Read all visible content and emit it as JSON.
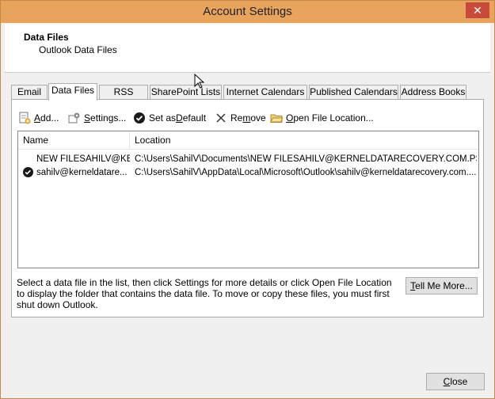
{
  "window": {
    "title": "Account Settings",
    "close_glyph": "✕"
  },
  "header": {
    "title": "Data Files",
    "subtitle": "Outlook Data Files"
  },
  "tabs": [
    {
      "label": "Email"
    },
    {
      "label": "Data Files"
    },
    {
      "label": "RSS Feeds"
    },
    {
      "label": "SharePoint Lists"
    },
    {
      "label": "Internet Calendars"
    },
    {
      "label": "Published Calendars"
    },
    {
      "label": "Address Books"
    }
  ],
  "toolbar": {
    "add_prefix": "",
    "add_u": "A",
    "add_rest": "dd...",
    "settings_prefix": "",
    "settings_u": "S",
    "settings_rest": "ettings...",
    "default_prefix": "Set as ",
    "default_u": "D",
    "default_rest": "efault",
    "remove_prefix": "Re",
    "remove_u": "m",
    "remove_rest": "ove",
    "open_prefix": "",
    "open_u": "O",
    "open_rest": "pen File Location..."
  },
  "list": {
    "columns": [
      "Name",
      "Location"
    ],
    "rows": [
      {
        "name": "NEW FILESAHILV@KE...",
        "location": "C:\\Users\\SahilV\\Documents\\NEW FILESAHILV@KERNELDATARECOVERY.COM.PST",
        "default": false
      },
      {
        "name": "sahilv@kerneldatare...",
        "location": "C:\\Users\\SahilV\\AppData\\Local\\Microsoft\\Outlook\\sahilv@kerneldatarecovery.com....",
        "default": true
      }
    ]
  },
  "description": "Select a data file in the list, then click Settings for more details or click Open File Location to display the folder that contains the data file. To move or copy these files, you must first shut down Outlook.",
  "buttons": {
    "tell_me_u": "T",
    "tell_me_rest": "ell Me More...",
    "close_u": "C",
    "close_rest": "lose"
  },
  "colors": {
    "titlebar": "#e8a35c",
    "close_button": "#c74a3a"
  }
}
